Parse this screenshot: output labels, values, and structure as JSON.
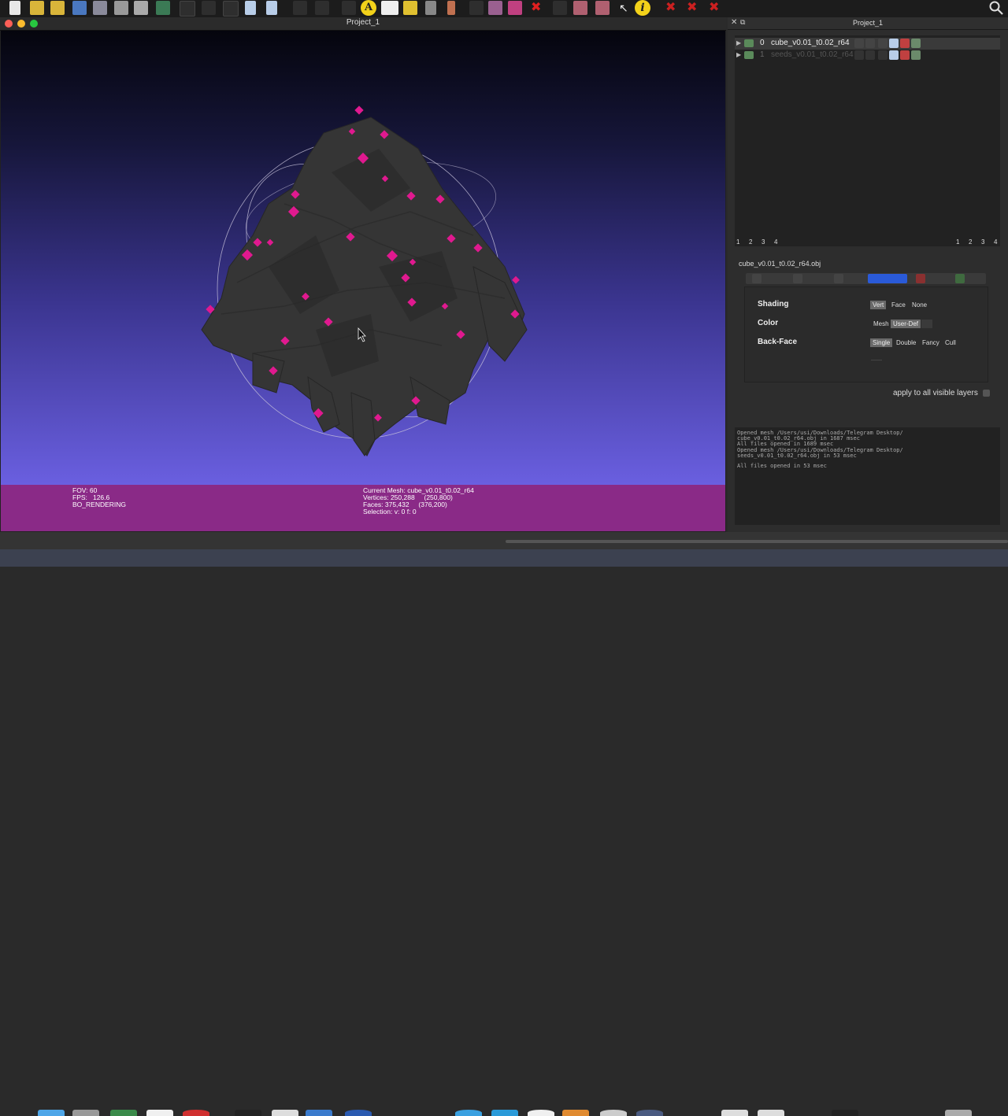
{
  "toolbar": {
    "icons": [
      "new-file-icon",
      "open-file-icon",
      "open-folder-icon",
      "reload-icon",
      "layers-icon",
      "snapshot-icon",
      "stack-icon",
      "green-screen-icon",
      "bbox-icon",
      "points-icon",
      "wire-icon",
      "cylinder-icon",
      "cylinder2-icon",
      "cube-icon",
      "axis-icon",
      "annotate-icon",
      "axes-icon",
      "hand-icon",
      "camera-icon",
      "pencil-icon",
      "select-icon",
      "paint-icon",
      "delete-icon",
      "select-faces-icon",
      "select-verts-icon",
      "select-edges-icon",
      "arrow-icon",
      "info-icon",
      "close-x-icon",
      "close-x2-icon",
      "close-x3-icon"
    ],
    "letter_a": "A",
    "letter_i": "i"
  },
  "viewer": {
    "title": "Project_1"
  },
  "status": {
    "fov": "FOV: 60",
    "fps": "FPS:   126.6",
    "mode": "BO_RENDERING",
    "current_mesh": "Current Mesh: cube_v0.01_t0.02_r64",
    "vertices": "Vertices: 250,288     (250,800)",
    "faces": "Faces: 375,432     (376,200)",
    "selection": "Selection: v: 0 f: 0"
  },
  "panel": {
    "title": "Project_1",
    "layers": [
      {
        "index": "0",
        "name": "cube_v0.01_t0.02_r64"
      },
      {
        "index": "1",
        "name": "seeds_v0.01_t0.02_r64"
      }
    ],
    "tabs_left": [
      "1",
      "2",
      "3",
      "4"
    ],
    "tabs_right": [
      "1",
      "2",
      "3",
      "4"
    ],
    "file": "cube_v0.01_t0.02_r64.obj",
    "shading": {
      "label": "Shading",
      "options": [
        "Vert",
        "Face",
        "None"
      ],
      "selected": "Vert"
    },
    "color": {
      "label": "Color",
      "options": [
        "Mesh",
        "User-Def"
      ],
      "selected": "User-Def"
    },
    "backface": {
      "label": "Back-Face",
      "options": [
        "Single",
        "Double",
        "Fancy",
        "Cull"
      ],
      "selected": "Single"
    },
    "apply_all": "apply to all visible layers"
  },
  "log": [
    "Opened mesh /Users/usi/Downloads/Telegram Desktop/",
    "cube_v0.01_t0.02_r64.obj in 1687 msec",
    "All files opened in 1689 msec",
    "Opened mesh /Users/usi/Downloads/Telegram Desktop/",
    "seeds_v0.01_t0.02_r64.obj in 53 msec",
    "",
    "All files opened in 53 msec"
  ],
  "colors": {
    "status_bar": "#8a2a87",
    "seed_points": "#e0198f",
    "mesh": "#3a3a3a",
    "viewport_bottom": "#6a5fe0"
  }
}
